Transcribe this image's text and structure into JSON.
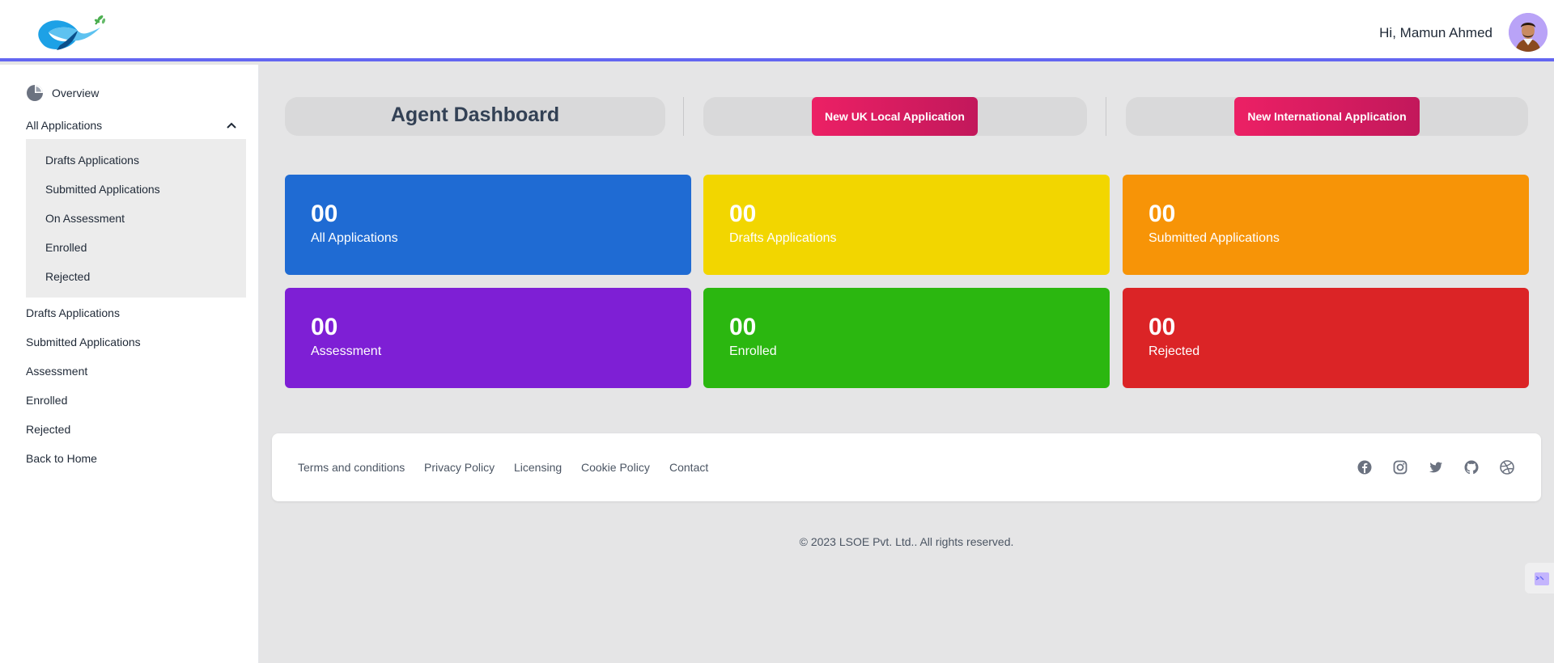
{
  "header": {
    "greeting": "Hi, Mamun Ahmed"
  },
  "sidebar": {
    "overview": "Overview",
    "all_applications": "All Applications",
    "sub_items": [
      "Drafts Applications",
      "Submitted Applications",
      "On Assessment",
      "Enrolled",
      "Rejected"
    ],
    "items": [
      "Drafts Applications",
      "Submitted Applications",
      "Assessment",
      "Enrolled",
      "Rejected",
      "Back to Home"
    ]
  },
  "main": {
    "title": "Agent Dashboard",
    "btn_uk": "New UK Local Application",
    "btn_international": "New International Application",
    "cards": [
      {
        "value": "00",
        "label": "All Applications",
        "color": "#1f6bd3"
      },
      {
        "value": "00",
        "label": "Drafts Applications",
        "color": "#f2d600"
      },
      {
        "value": "00",
        "label": "Submitted Applications",
        "color": "#f79407"
      },
      {
        "value": "00",
        "label": "Assessment",
        "color": "#7e1fd5"
      },
      {
        "value": "00",
        "label": "Enrolled",
        "color": "#2bb710"
      },
      {
        "value": "00",
        "label": "Rejected",
        "color": "#db2426"
      }
    ]
  },
  "footer": {
    "links": [
      "Terms and conditions",
      "Privacy Policy",
      "Licensing",
      "Cookie Policy",
      "Contact"
    ],
    "social_icons": [
      "facebook-icon",
      "instagram-icon",
      "twitter-icon",
      "github-icon",
      "dribbble-icon"
    ],
    "copyright": "© 2023 LSOE Pvt. Ltd.. All rights reserved."
  },
  "colors": {
    "accent": "#6366f1",
    "pink_button": "#e91e63"
  }
}
